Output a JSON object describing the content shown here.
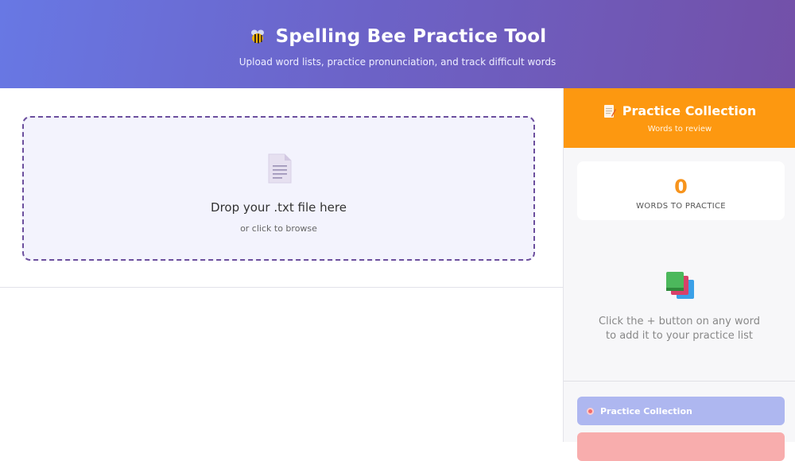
{
  "header": {
    "title": "Spelling Bee Practice Tool",
    "subtitle": "Upload word lists, practice pronunciation, and track difficult words",
    "icon": "bee-icon"
  },
  "upload": {
    "drop_text": "Drop your .txt file here",
    "drop_sub": "or click to browse",
    "icon": "file-icon"
  },
  "sidebar": {
    "title": "Practice Collection",
    "subtitle": "Words to review",
    "count_value": "0",
    "count_label": "WORDS TO PRACTICE",
    "empty_line1": "Click the + button on any word",
    "empty_line2": "to add it to your practice list",
    "practice_button": "Practice Collection"
  },
  "colors": {
    "header_start": "#6878e4",
    "header_end": "#7350a8",
    "sidebar_accent": "#fd9810",
    "dropzone_border": "#6c4f9e",
    "practice_button": "#aeb7f0",
    "clear_button": "#f8adad"
  }
}
